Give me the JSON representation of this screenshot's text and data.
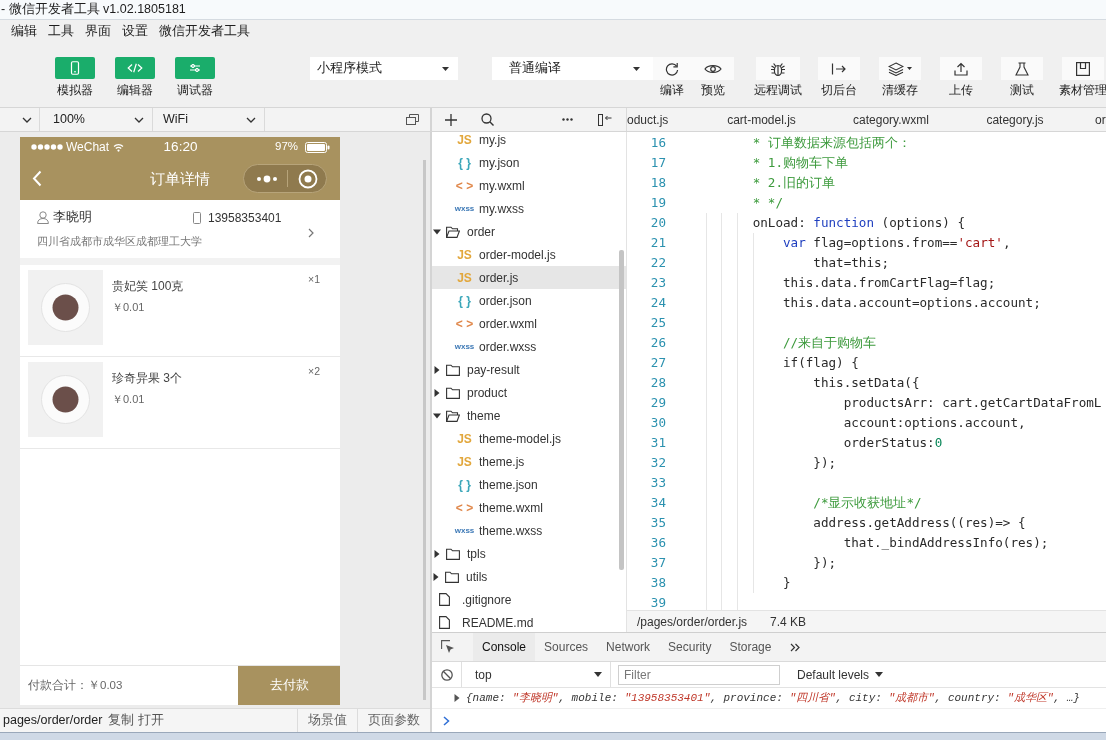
{
  "window": {
    "title": "- 微信开发者工具 v1.02.1805181"
  },
  "menu": [
    "编辑",
    "工具",
    "界面",
    "设置",
    "微信开发者工具"
  ],
  "toolbar": {
    "panels": [
      {
        "kind": "simulator",
        "label": "模拟器",
        "on": true
      },
      {
        "kind": "editor",
        "label": "编辑器",
        "on": true
      },
      {
        "kind": "debugger",
        "label": "调试器",
        "on": true
      }
    ],
    "mode_select": {
      "value": "小程序模式"
    },
    "compile_select": {
      "value": "普通编译"
    },
    "actions": [
      {
        "kind": "compile",
        "label": "编译"
      },
      {
        "kind": "preview",
        "label": "预览"
      },
      {
        "kind": "remote_debug",
        "label": "远程调试"
      },
      {
        "kind": "background",
        "label": "切后台"
      },
      {
        "kind": "clear_cache",
        "label": "清缓存"
      },
      {
        "kind": "upload",
        "label": "上传"
      },
      {
        "kind": "test",
        "label": "测试"
      },
      {
        "kind": "assets",
        "label": "素材管理"
      }
    ]
  },
  "simulator_bar": {
    "zoom_select": {
      "value": "100%"
    },
    "network_select": {
      "value": "WiFi"
    }
  },
  "editor_tabs": [
    {
      "label": "oduct.js",
      "selected": false
    },
    {
      "label": "cart-model.js",
      "selected": false
    },
    {
      "label": "category.wxml",
      "selected": false
    },
    {
      "label": "category.js",
      "selected": false
    },
    {
      "label": "or",
      "selected": false
    }
  ],
  "phone": {
    "status_bar": {
      "carrier": "WeChat",
      "time": "16:20",
      "battery": "97%"
    },
    "nav": {
      "title": "订单详情"
    },
    "address": {
      "name": "李晓明",
      "mobile": "13958353401",
      "detail": "四川省成都市成华区成都理工大学"
    },
    "products": [
      {
        "name": "贵妃笑 100克",
        "price": "￥0.01",
        "quantity": "×1"
      },
      {
        "name": "珍奇异果 3个",
        "price": "￥0.01",
        "quantity": "×2"
      }
    ],
    "footer": {
      "total": "付款合计：￥0.03",
      "pay_button": "去付款"
    }
  },
  "simulator_status": {
    "path": "pages/order/order",
    "actions": [
      "复制",
      "打开"
    ],
    "panels": [
      "场景值",
      "页面参数"
    ]
  },
  "file_tree": [
    {
      "kind": "hidden_parent",
      "children": [
        {
          "kind": "hidden_parent",
          "children": [
            {
              "kind": "file",
              "badge": "JS",
              "color": "#e2a73c",
              "name": "my.js",
              "selected": false
            },
            {
              "kind": "file",
              "badge": "{ }",
              "color": "#3aa6b9",
              "name": "my.json",
              "selected": false
            },
            {
              "kind": "file",
              "badge": "< >",
              "color": "#e0874a",
              "name": "my.wxml",
              "selected": false
            },
            {
              "kind": "file",
              "badge": "wxss",
              "color": "#3d79b6",
              "name": "my.wxss",
              "selected": false
            }
          ]
        },
        {
          "kind": "folder",
          "name": "order",
          "expanded": true,
          "selected": false,
          "children": [
            {
              "kind": "file",
              "badge": "JS",
              "color": "#e2a73c",
              "name": "order-model.js",
              "selected": false
            },
            {
              "kind": "file",
              "badge": "JS",
              "color": "#e2a73c",
              "name": "order.js",
              "selected": true
            },
            {
              "kind": "file",
              "badge": "{ }",
              "color": "#3aa6b9",
              "name": "order.json",
              "selected": false
            },
            {
              "kind": "file",
              "badge": "< >",
              "color": "#e0874a",
              "name": "order.wxml",
              "selected": false
            },
            {
              "kind": "file",
              "badge": "wxss",
              "color": "#3d79b6",
              "name": "order.wxss",
              "selected": false
            }
          ]
        },
        {
          "kind": "folder",
          "name": "pay-result",
          "expanded": false,
          "selected": false
        },
        {
          "kind": "folder",
          "name": "product",
          "expanded": false,
          "selected": false
        },
        {
          "kind": "folder",
          "name": "theme",
          "expanded": true,
          "selected": false,
          "children": [
            {
              "kind": "file",
              "badge": "JS",
              "color": "#e2a73c",
              "name": "theme-model.js",
              "selected": false
            },
            {
              "kind": "file",
              "badge": "JS",
              "color": "#e2a73c",
              "name": "theme.js",
              "selected": false
            },
            {
              "kind": "file",
              "badge": "{ }",
              "color": "#3aa6b9",
              "name": "theme.json",
              "selected": false
            },
            {
              "kind": "file",
              "badge": "< >",
              "color": "#e0874a",
              "name": "theme.wxml",
              "selected": false
            },
            {
              "kind": "file",
              "badge": "wxss",
              "color": "#3d79b6",
              "name": "theme.wxss",
              "selected": false
            }
          ]
        },
        {
          "kind": "folder",
          "name": "tpls",
          "expanded": false,
          "selected": false
        }
      ]
    },
    {
      "kind": "folder",
      "name": "utils",
      "expanded": false,
      "selected": false
    },
    {
      "kind": "file",
      "name": ".gitignore",
      "selected": false
    },
    {
      "kind": "file",
      "name": "README.md",
      "selected": false
    }
  ],
  "editor": {
    "lines": [
      {
        "number": "16",
        "tokens": [
          {
            "kind": "comment",
            "text": "        * 订单数据来源包括两个："
          }
        ]
      },
      {
        "number": "17",
        "tokens": [
          {
            "kind": "comment",
            "text": "        * 1.购物车下单"
          }
        ]
      },
      {
        "number": "18",
        "tokens": [
          {
            "kind": "comment",
            "text": "        * 2.旧的订单"
          }
        ]
      },
      {
        "number": "19",
        "tokens": [
          {
            "kind": "comment",
            "text": "        * */"
          }
        ]
      },
      {
        "number": "20",
        "tokens": [
          {
            "kind": "plain",
            "text": "        onLoad: "
          },
          {
            "kind": "keyword",
            "text": "function"
          },
          {
            "kind": "plain",
            "text": " (options) {"
          }
        ]
      },
      {
        "number": "21",
        "tokens": [
          {
            "kind": "keyword",
            "text": "            var"
          },
          {
            "kind": "plain",
            "text": " flag=options.from=="
          },
          {
            "kind": "string",
            "text": "'cart'"
          },
          {
            "kind": "plain",
            "text": ","
          }
        ]
      },
      {
        "number": "22",
        "tokens": [
          {
            "kind": "plain",
            "text": "                that=this;"
          }
        ]
      },
      {
        "number": "23",
        "tokens": [
          {
            "kind": "plain",
            "text": "            this.data.fromCartFlag=flag;"
          }
        ]
      },
      {
        "number": "24",
        "tokens": [
          {
            "kind": "plain",
            "text": "            this.data.account=options.account;"
          }
        ]
      },
      {
        "number": "25"
      },
      {
        "number": "26",
        "tokens": [
          {
            "kind": "comment",
            "text": "            //来自于购物车"
          }
        ]
      },
      {
        "number": "27",
        "tokens": [
          {
            "kind": "plain",
            "text": "            if(flag) {"
          }
        ]
      },
      {
        "number": "28",
        "tokens": [
          {
            "kind": "plain",
            "text": "                this.setData({"
          }
        ]
      },
      {
        "number": "29",
        "tokens": [
          {
            "kind": "plain",
            "text": "                    productsArr: cart.getCartDataFromL"
          }
        ]
      },
      {
        "number": "30",
        "tokens": [
          {
            "kind": "plain",
            "text": "                    account:options.account,"
          }
        ]
      },
      {
        "number": "31",
        "tokens": [
          {
            "kind": "plain",
            "text": "                    orderStatus:"
          },
          {
            "kind": "number",
            "text": "0"
          }
        ]
      },
      {
        "number": "32",
        "tokens": [
          {
            "kind": "plain",
            "text": "                });"
          }
        ]
      },
      {
        "number": "33"
      },
      {
        "number": "34",
        "tokens": [
          {
            "kind": "comment",
            "text": "                /*显示收获地址*/"
          }
        ]
      },
      {
        "number": "35",
        "tokens": [
          {
            "kind": "plain",
            "text": "                address.getAddress((res)=> {"
          }
        ]
      },
      {
        "number": "36",
        "tokens": [
          {
            "kind": "plain",
            "text": "                    that._bindAddressInfo(res);"
          }
        ]
      },
      {
        "number": "37",
        "tokens": [
          {
            "kind": "plain",
            "text": "                });"
          }
        ]
      },
      {
        "number": "38",
        "tokens": [
          {
            "kind": "plain",
            "text": "            }"
          }
        ]
      },
      {
        "number": "39"
      }
    ],
    "status": {
      "path": "/pages/order/order.js",
      "size": "7.4 KB"
    }
  },
  "console": {
    "tabs": [
      {
        "label": "Console",
        "selected": true
      },
      {
        "label": "Sources",
        "selected": false
      },
      {
        "label": "Network",
        "selected": false
      },
      {
        "label": "Security",
        "selected": false
      },
      {
        "label": "Storage",
        "selected": false
      }
    ],
    "context_select": {
      "value": "top"
    },
    "filter": {
      "placeholder": "Filter"
    },
    "levels_select": {
      "value": "Default levels"
    },
    "log": [
      {
        "expanded": false,
        "tokens": [
          {
            "kind": "plain",
            "text": "{name: "
          },
          {
            "kind": "string",
            "text": "\"李晓明\""
          },
          {
            "kind": "plain",
            "text": ", mobile: "
          },
          {
            "kind": "string",
            "text": "\"13958353401\""
          },
          {
            "kind": "plain",
            "text": ", province: "
          },
          {
            "kind": "string",
            "text": "\"四川省\""
          },
          {
            "kind": "plain",
            "text": ", city: "
          },
          {
            "kind": "string",
            "text": "\"成都市\""
          },
          {
            "kind": "plain",
            "text": ", country: "
          },
          {
            "kind": "string",
            "text": "\"成华区\""
          },
          {
            "kind": "plain",
            "text": ", …}"
          }
        ]
      }
    ]
  }
}
